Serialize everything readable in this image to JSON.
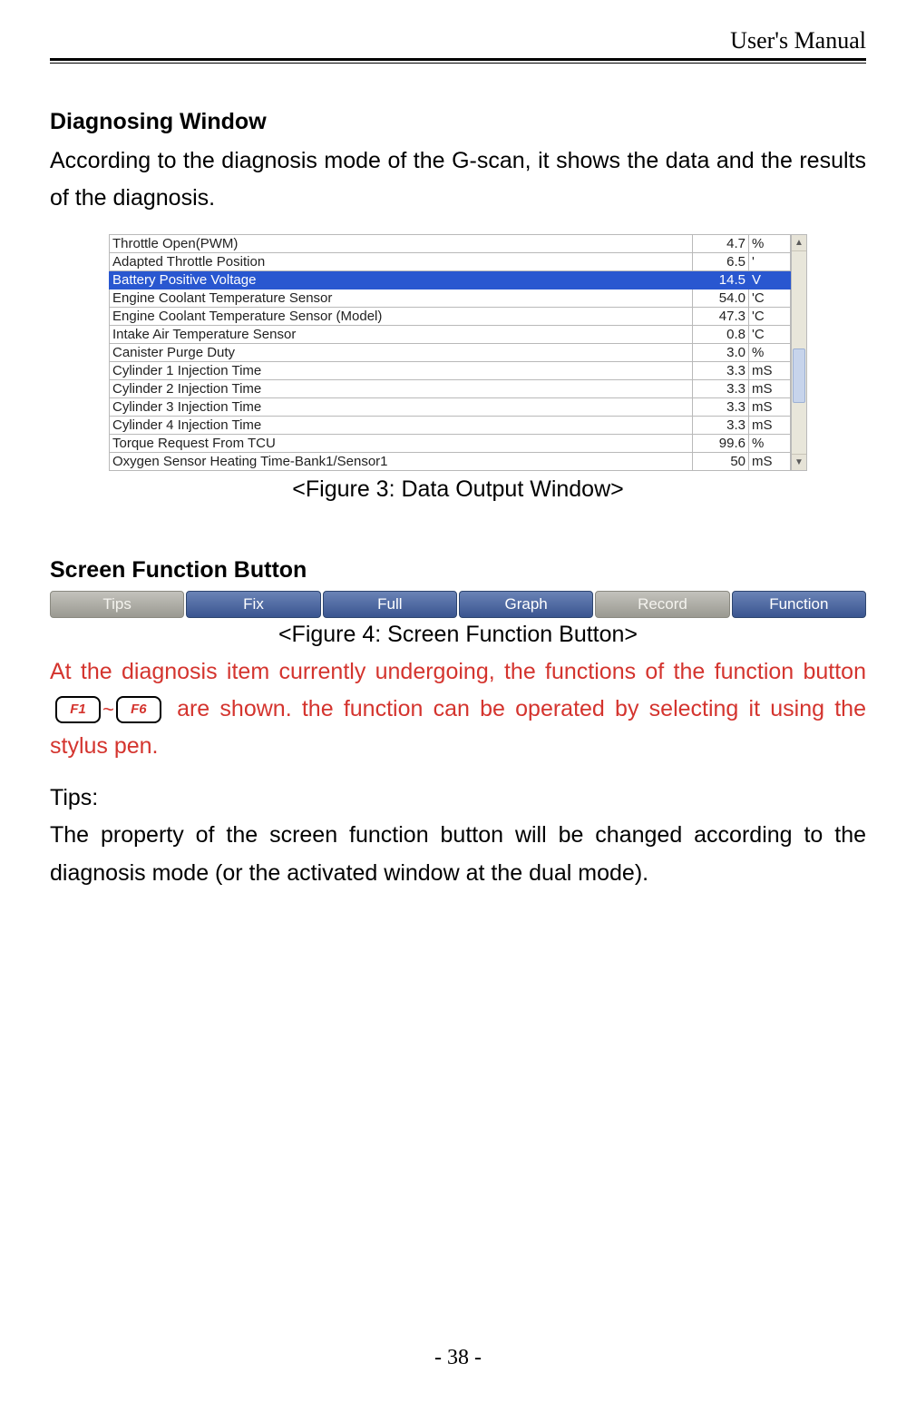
{
  "header": {
    "title": "User's Manual"
  },
  "section1": {
    "heading": "Diagnosing Window",
    "body": "According to the diagnosis mode of the G-scan, it shows the data and the results of the diagnosis."
  },
  "figure3": {
    "caption": "<Figure 3: Data Output Window>",
    "selected_index": 2,
    "rows": [
      {
        "name": "Throttle Open(PWM)",
        "value": "4.7",
        "unit": "%"
      },
      {
        "name": "Adapted Throttle Position",
        "value": "6.5",
        "unit": "'"
      },
      {
        "name": "Battery Positive Voltage",
        "value": "14.5",
        "unit": "V"
      },
      {
        "name": "Engine Coolant Temperature Sensor",
        "value": "54.0",
        "unit": "'C"
      },
      {
        "name": "Engine Coolant Temperature Sensor (Model)",
        "value": "47.3",
        "unit": "'C"
      },
      {
        "name": "Intake Air Temperature Sensor",
        "value": "0.8",
        "unit": "'C"
      },
      {
        "name": "Canister Purge Duty",
        "value": "3.0",
        "unit": "%"
      },
      {
        "name": "Cylinder 1 Injection Time",
        "value": "3.3",
        "unit": "mS"
      },
      {
        "name": "Cylinder 2 Injection Time",
        "value": "3.3",
        "unit": "mS"
      },
      {
        "name": "Cylinder 3 Injection Time",
        "value": "3.3",
        "unit": "mS"
      },
      {
        "name": "Cylinder 4 Injection Time",
        "value": "3.3",
        "unit": "mS"
      },
      {
        "name": "Torque Request From TCU",
        "value": "99.6",
        "unit": "%"
      },
      {
        "name": "Oxygen Sensor Heating Time-Bank1/Sensor1",
        "value": "50",
        "unit": "mS"
      }
    ]
  },
  "section2": {
    "heading": "Screen Function Button",
    "buttons": [
      {
        "label": "Tips",
        "active": false
      },
      {
        "label": "Fix",
        "active": true
      },
      {
        "label": "Full",
        "active": true
      },
      {
        "label": "Graph",
        "active": true
      },
      {
        "label": "Record",
        "active": false
      },
      {
        "label": "Function",
        "active": true
      }
    ],
    "caption": "<Figure 4: Screen Function Button>",
    "red_before": "At the diagnosis item currently undergoing, the functions of the function button ",
    "key1": "F1",
    "tilde": "~",
    "key2": "F6",
    "red_after": " are shown. the function can be operated by selecting it using the stylus pen."
  },
  "tips": {
    "label": "Tips:",
    "body": "The property of the screen function button will be changed according to the diagnosis mode (or the activated window at the dual mode)."
  },
  "footer": {
    "page": "- 38 -"
  }
}
